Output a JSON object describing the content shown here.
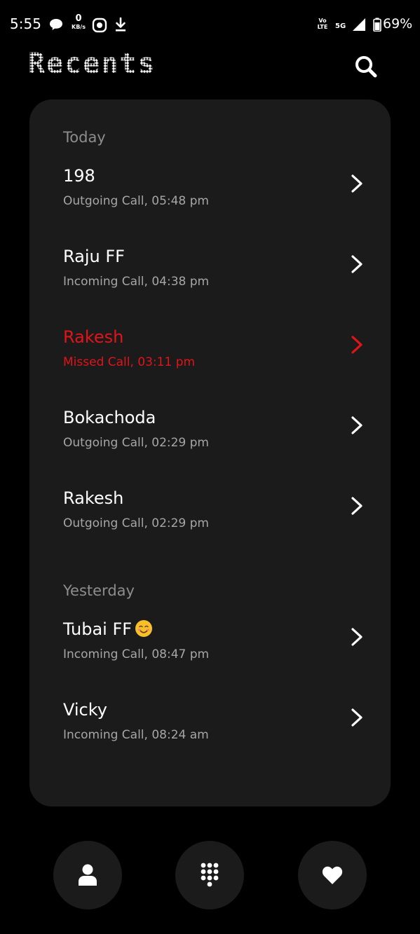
{
  "status_bar": {
    "time": "5:55",
    "net_speed_value": "0",
    "net_speed_unit": "KB/s",
    "volte_line1": "Vo",
    "volte_line2": "LTE",
    "network": "5G",
    "battery": "69%",
    "icons": [
      "chat-bubble-icon",
      "screen-record-icon",
      "download-icon",
      "signal-icon",
      "battery-icon"
    ]
  },
  "header": {
    "title": "Recents",
    "search_icon": "search-icon"
  },
  "colors": {
    "background": "#000000",
    "card": "#1b1b1b",
    "missed": "#e1141a",
    "secondary_text": "#a6a6a6",
    "section_label": "#8d8d8d"
  },
  "sections": [
    {
      "label": "Today",
      "calls": [
        {
          "name": "198",
          "detail": "Outgoing Call, 05:48 pm",
          "missed": false
        },
        {
          "name": "Raju FF",
          "detail": "Incoming Call, 04:38 pm",
          "missed": false
        },
        {
          "name": "Rakesh",
          "detail": "Missed Call, 03:11 pm",
          "missed": true
        },
        {
          "name": "Bokachoda",
          "detail": "Outgoing Call, 02:29 pm",
          "missed": false
        },
        {
          "name": "Rakesh",
          "detail": "Outgoing Call, 02:29 pm",
          "missed": false
        }
      ]
    },
    {
      "label": "Yesterday",
      "calls": [
        {
          "name": "Tubai FF",
          "emoji": "smiling-face-icon",
          "detail": "Incoming Call, 08:47 pm",
          "missed": false
        },
        {
          "name": "Vicky",
          "detail": "Incoming Call, 08:24 am",
          "missed": false
        }
      ]
    }
  ],
  "bottom_nav": [
    {
      "icon": "contacts-icon"
    },
    {
      "icon": "dialpad-icon"
    },
    {
      "icon": "favorites-heart-icon"
    }
  ]
}
